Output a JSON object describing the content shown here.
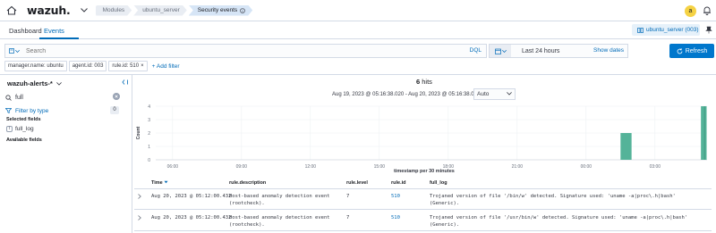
{
  "app": {
    "logo_text": "wazuh."
  },
  "breadcrumbs": [
    {
      "label": "Modules"
    },
    {
      "label": "ubuntu_server"
    },
    {
      "label": "Security events"
    }
  ],
  "user": {
    "avatar_initial": "a"
  },
  "tabs": [
    {
      "label": "Dashboard"
    },
    {
      "label": "Events"
    }
  ],
  "agent_chip": {
    "label": "ubuntu_server (003)"
  },
  "search": {
    "placeholder": "Search",
    "value": "",
    "language_label": "DQL"
  },
  "time": {
    "range_label": "Last 24 hours",
    "show_dates_label": "Show dates",
    "refresh_label": "Refresh"
  },
  "filters": {
    "pills": [
      {
        "label": "manager.name: ubuntu"
      },
      {
        "label": "agent.id: 003"
      },
      {
        "label": "rule.id: 510"
      }
    ],
    "add_label": "+ Add filter"
  },
  "sidebar": {
    "index_pattern": "wazuh-alerts-*",
    "field_search": "full",
    "filter_by_type_label": "Filter by type",
    "filter_count": "0",
    "selected_heading": "Selected fields",
    "selected_fields": [
      {
        "type_badge": "t",
        "name": "full_log"
      }
    ],
    "available_heading": "Available fields"
  },
  "main": {
    "hits_count": "6",
    "hits_label": "hits",
    "date_range": "Aug 19, 2023 @ 05:16:38.020 - Aug 20, 2023 @ 05:16:38.021",
    "interval_value": "Auto",
    "x_axis_title": "timestamp per 30 minutes"
  },
  "chart_data": {
    "type": "bar",
    "title": "",
    "xlabel": "timestamp per 30 minutes",
    "ylabel": "Count",
    "ylim": [
      0,
      4
    ],
    "yticks": [
      0,
      1,
      2,
      3,
      4
    ],
    "xticks": [
      "06:00",
      "09:00",
      "12:00",
      "15:00",
      "18:00",
      "21:00",
      "00:00",
      "03:00"
    ],
    "grid": true,
    "color": "#54b399",
    "series": [
      {
        "values": [
          {
            "x": "Aug 20, 2023 @ 01:30",
            "y": 2
          },
          {
            "x": "Aug 20, 2023 @ 05:00",
            "y": 4
          }
        ]
      }
    ]
  },
  "table": {
    "columns": [
      "Time",
      "rule.description",
      "rule.level",
      "rule.id",
      "full_log"
    ],
    "rows": [
      {
        "time": "Aug 20, 2023 @ 05:12:00.432",
        "description": "Host-based anomaly detection event (rootcheck).",
        "level": "7",
        "rule_id": "510",
        "full_log": "Trojaned version of file '/bin/w' detected. Signature used: 'uname -a|proc\\.h|bash' (Generic)."
      },
      {
        "time": "Aug 20, 2023 @ 05:12:00.432",
        "description": "Host-based anomaly detection event (rootcheck).",
        "level": "7",
        "rule_id": "510",
        "full_log": "Trojaned version of file '/usr/bin/w' detected. Signature used: 'uname -a|proc\\.h|bash' (Generic)."
      }
    ]
  }
}
